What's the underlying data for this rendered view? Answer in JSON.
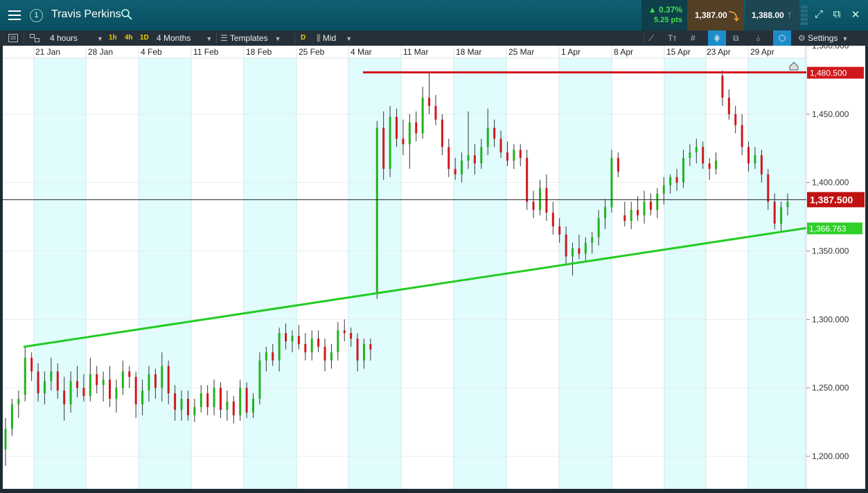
{
  "header": {
    "menu_icon": "hamburger-icon",
    "window_number": "1",
    "title": "Travis Perkins",
    "change_pct": "0.37%",
    "change_pts": "5.25 pts",
    "sell_price": "1,387.00",
    "buy_price": "1,388.00",
    "up_color": "#3fe04a"
  },
  "toolbar": {
    "interval": "4 hours",
    "quick_1h": "1h",
    "quick_4h": "4h",
    "quick_1d": "1D",
    "range": "4 Months",
    "templates": "Templates",
    "d_label": "D",
    "price_type": "Mid",
    "settings": "Settings"
  },
  "chart_data": {
    "type": "candlestick",
    "x_ticks": [
      "21 Jan",
      "28 Jan",
      "4 Feb",
      "11 Feb",
      "18 Feb",
      "25 Feb",
      "4 Mar",
      "11 Mar",
      "18 Mar",
      "25 Mar",
      "1 Apr",
      "8 Apr",
      "15 Apr",
      "23 Apr",
      "29 Apr"
    ],
    "y_ticks": [
      1200,
      1250,
      1300,
      1350,
      1400,
      1450,
      1500
    ],
    "y_tick_labels": [
      "1,200.000",
      "1,250.000",
      "1,300.000",
      "1,350.000",
      "1,400.000",
      "1,450.000",
      "1,500.000"
    ],
    "ylim": [
      1185,
      1506
    ],
    "up_color": "#22b21f",
    "down_color": "#d0171d",
    "current_price": 1387.5,
    "current_price_label": "1,387.500",
    "resistance": {
      "value": 1480.5,
      "label": "1,480.500",
      "color": "#d0171d"
    },
    "support": {
      "value": 1366.763,
      "label": "1,366.763",
      "color": "#22cc22",
      "from": 1280,
      "to": 1366.763
    },
    "series": [
      {
        "o": 1205,
        "h": 1228,
        "l": 1193,
        "c": 1220
      },
      {
        "o": 1220,
        "h": 1242,
        "l": 1215,
        "c": 1238
      },
      {
        "o": 1238,
        "h": 1248,
        "l": 1228,
        "c": 1242
      },
      {
        "o": 1245,
        "h": 1280,
        "l": 1240,
        "c": 1272
      },
      {
        "o": 1272,
        "h": 1276,
        "l": 1255,
        "c": 1262
      },
      {
        "o": 1262,
        "h": 1268,
        "l": 1240,
        "c": 1246
      },
      {
        "o": 1246,
        "h": 1262,
        "l": 1238,
        "c": 1255
      },
      {
        "o": 1255,
        "h": 1272,
        "l": 1248,
        "c": 1262
      },
      {
        "o": 1262,
        "h": 1268,
        "l": 1242,
        "c": 1248
      },
      {
        "o": 1248,
        "h": 1258,
        "l": 1226,
        "c": 1238
      },
      {
        "o": 1238,
        "h": 1262,
        "l": 1232,
        "c": 1255
      },
      {
        "o": 1255,
        "h": 1266,
        "l": 1243,
        "c": 1250
      },
      {
        "o": 1250,
        "h": 1260,
        "l": 1240,
        "c": 1244
      },
      {
        "o": 1244,
        "h": 1272,
        "l": 1240,
        "c": 1260
      },
      {
        "o": 1260,
        "h": 1266,
        "l": 1246,
        "c": 1252
      },
      {
        "o": 1252,
        "h": 1262,
        "l": 1240,
        "c": 1256
      },
      {
        "o": 1256,
        "h": 1266,
        "l": 1236,
        "c": 1242
      },
      {
        "o": 1242,
        "h": 1256,
        "l": 1232,
        "c": 1250
      },
      {
        "o": 1250,
        "h": 1270,
        "l": 1245,
        "c": 1262
      },
      {
        "o": 1262,
        "h": 1266,
        "l": 1250,
        "c": 1258
      },
      {
        "o": 1258,
        "h": 1262,
        "l": 1228,
        "c": 1238
      },
      {
        "o": 1238,
        "h": 1256,
        "l": 1230,
        "c": 1248
      },
      {
        "o": 1248,
        "h": 1266,
        "l": 1240,
        "c": 1260
      },
      {
        "o": 1260,
        "h": 1264,
        "l": 1242,
        "c": 1250
      },
      {
        "o": 1250,
        "h": 1276,
        "l": 1240,
        "c": 1266
      },
      {
        "o": 1266,
        "h": 1270,
        "l": 1238,
        "c": 1246
      },
      {
        "o": 1246,
        "h": 1252,
        "l": 1226,
        "c": 1234
      },
      {
        "o": 1234,
        "h": 1248,
        "l": 1226,
        "c": 1242
      },
      {
        "o": 1242,
        "h": 1248,
        "l": 1226,
        "c": 1230
      },
      {
        "o": 1230,
        "h": 1242,
        "l": 1225,
        "c": 1236
      },
      {
        "o": 1236,
        "h": 1252,
        "l": 1232,
        "c": 1246
      },
      {
        "o": 1246,
        "h": 1252,
        "l": 1230,
        "c": 1236
      },
      {
        "o": 1236,
        "h": 1256,
        "l": 1230,
        "c": 1250
      },
      {
        "o": 1250,
        "h": 1254,
        "l": 1228,
        "c": 1234
      },
      {
        "o": 1234,
        "h": 1248,
        "l": 1226,
        "c": 1240
      },
      {
        "o": 1240,
        "h": 1244,
        "l": 1224,
        "c": 1230
      },
      {
        "o": 1230,
        "h": 1256,
        "l": 1226,
        "c": 1250
      },
      {
        "o": 1250,
        "h": 1254,
        "l": 1228,
        "c": 1232
      },
      {
        "o": 1232,
        "h": 1246,
        "l": 1228,
        "c": 1242
      },
      {
        "o": 1242,
        "h": 1276,
        "l": 1238,
        "c": 1270
      },
      {
        "o": 1270,
        "h": 1280,
        "l": 1262,
        "c": 1276
      },
      {
        "o": 1276,
        "h": 1282,
        "l": 1266,
        "c": 1270
      },
      {
        "o": 1270,
        "h": 1294,
        "l": 1262,
        "c": 1290
      },
      {
        "o": 1290,
        "h": 1297,
        "l": 1278,
        "c": 1284
      },
      {
        "o": 1284,
        "h": 1292,
        "l": 1276,
        "c": 1288
      },
      {
        "o": 1288,
        "h": 1296,
        "l": 1278,
        "c": 1282
      },
      {
        "o": 1282,
        "h": 1290,
        "l": 1270,
        "c": 1276
      },
      {
        "o": 1276,
        "h": 1292,
        "l": 1270,
        "c": 1286
      },
      {
        "o": 1286,
        "h": 1292,
        "l": 1276,
        "c": 1280
      },
      {
        "o": 1280,
        "h": 1286,
        "l": 1262,
        "c": 1270
      },
      {
        "o": 1270,
        "h": 1282,
        "l": 1264,
        "c": 1276
      },
      {
        "o": 1276,
        "h": 1298,
        "l": 1270,
        "c": 1292
      },
      {
        "o": 1292,
        "h": 1300,
        "l": 1284,
        "c": 1290
      },
      {
        "o": 1290,
        "h": 1294,
        "l": 1280,
        "c": 1286
      },
      {
        "o": 1286,
        "h": 1290,
        "l": 1262,
        "c": 1270
      },
      {
        "o": 1270,
        "h": 1286,
        "l": 1264,
        "c": 1282
      },
      {
        "o": 1282,
        "h": 1286,
        "l": 1270,
        "c": 1278
      },
      {
        "o": 1320,
        "h": 1445,
        "l": 1315,
        "c": 1440
      },
      {
        "o": 1440,
        "h": 1452,
        "l": 1402,
        "c": 1410
      },
      {
        "o": 1410,
        "h": 1456,
        "l": 1404,
        "c": 1448
      },
      {
        "o": 1448,
        "h": 1454,
        "l": 1426,
        "c": 1432
      },
      {
        "o": 1432,
        "h": 1446,
        "l": 1420,
        "c": 1428
      },
      {
        "o": 1428,
        "h": 1450,
        "l": 1410,
        "c": 1444
      },
      {
        "o": 1444,
        "h": 1452,
        "l": 1430,
        "c": 1436
      },
      {
        "o": 1436,
        "h": 1470,
        "l": 1432,
        "c": 1462
      },
      {
        "o": 1462,
        "h": 1481,
        "l": 1450,
        "c": 1456
      },
      {
        "o": 1456,
        "h": 1464,
        "l": 1442,
        "c": 1446
      },
      {
        "o": 1446,
        "h": 1450,
        "l": 1420,
        "c": 1426
      },
      {
        "o": 1426,
        "h": 1432,
        "l": 1404,
        "c": 1410
      },
      {
        "o": 1410,
        "h": 1418,
        "l": 1402,
        "c": 1406
      },
      {
        "o": 1406,
        "h": 1422,
        "l": 1400,
        "c": 1416
      },
      {
        "o": 1416,
        "h": 1452,
        "l": 1410,
        "c": 1420
      },
      {
        "o": 1420,
        "h": 1428,
        "l": 1406,
        "c": 1414
      },
      {
        "o": 1414,
        "h": 1432,
        "l": 1410,
        "c": 1426
      },
      {
        "o": 1426,
        "h": 1454,
        "l": 1420,
        "c": 1440
      },
      {
        "o": 1440,
        "h": 1446,
        "l": 1426,
        "c": 1432
      },
      {
        "o": 1432,
        "h": 1438,
        "l": 1418,
        "c": 1422
      },
      {
        "o": 1422,
        "h": 1430,
        "l": 1412,
        "c": 1416
      },
      {
        "o": 1416,
        "h": 1428,
        "l": 1410,
        "c": 1424
      },
      {
        "o": 1424,
        "h": 1428,
        "l": 1412,
        "c": 1418
      },
      {
        "o": 1418,
        "h": 1424,
        "l": 1380,
        "c": 1386
      },
      {
        "o": 1386,
        "h": 1394,
        "l": 1374,
        "c": 1380
      },
      {
        "o": 1380,
        "h": 1402,
        "l": 1376,
        "c": 1396
      },
      {
        "o": 1396,
        "h": 1406,
        "l": 1372,
        "c": 1378
      },
      {
        "o": 1378,
        "h": 1386,
        "l": 1362,
        "c": 1368
      },
      {
        "o": 1368,
        "h": 1374,
        "l": 1356,
        "c": 1362
      },
      {
        "o": 1362,
        "h": 1368,
        "l": 1340,
        "c": 1346
      },
      {
        "o": 1346,
        "h": 1356,
        "l": 1332,
        "c": 1352
      },
      {
        "o": 1352,
        "h": 1362,
        "l": 1344,
        "c": 1348
      },
      {
        "o": 1348,
        "h": 1360,
        "l": 1342,
        "c": 1356
      },
      {
        "o": 1356,
        "h": 1364,
        "l": 1348,
        "c": 1360
      },
      {
        "o": 1360,
        "h": 1380,
        "l": 1354,
        "c": 1374
      },
      {
        "o": 1374,
        "h": 1388,
        "l": 1366,
        "c": 1382
      },
      {
        "o": 1382,
        "h": 1424,
        "l": 1378,
        "c": 1418
      },
      {
        "o": 1418,
        "h": 1422,
        "l": 1404,
        "c": 1408
      },
      {
        "o": 1376,
        "h": 1386,
        "l": 1368,
        "c": 1372
      },
      {
        "o": 1372,
        "h": 1386,
        "l": 1366,
        "c": 1380
      },
      {
        "o": 1380,
        "h": 1390,
        "l": 1372,
        "c": 1376
      },
      {
        "o": 1376,
        "h": 1394,
        "l": 1370,
        "c": 1386
      },
      {
        "o": 1386,
        "h": 1392,
        "l": 1376,
        "c": 1380
      },
      {
        "o": 1380,
        "h": 1396,
        "l": 1374,
        "c": 1392
      },
      {
        "o": 1392,
        "h": 1404,
        "l": 1384,
        "c": 1398
      },
      {
        "o": 1398,
        "h": 1406,
        "l": 1392,
        "c": 1404
      },
      {
        "o": 1404,
        "h": 1410,
        "l": 1394,
        "c": 1400
      },
      {
        "o": 1400,
        "h": 1424,
        "l": 1396,
        "c": 1418
      },
      {
        "o": 1418,
        "h": 1428,
        "l": 1412,
        "c": 1422
      },
      {
        "o": 1422,
        "h": 1432,
        "l": 1414,
        "c": 1426
      },
      {
        "o": 1426,
        "h": 1430,
        "l": 1410,
        "c": 1414
      },
      {
        "o": 1414,
        "h": 1418,
        "l": 1402,
        "c": 1410
      },
      {
        "o": 1410,
        "h": 1422,
        "l": 1406,
        "c": 1416
      },
      {
        "o": 1478,
        "h": 1482,
        "l": 1456,
        "c": 1462
      },
      {
        "o": 1462,
        "h": 1468,
        "l": 1446,
        "c": 1450
      },
      {
        "o": 1450,
        "h": 1456,
        "l": 1436,
        "c": 1442
      },
      {
        "o": 1442,
        "h": 1450,
        "l": 1420,
        "c": 1426
      },
      {
        "o": 1426,
        "h": 1430,
        "l": 1408,
        "c": 1414
      },
      {
        "o": 1414,
        "h": 1426,
        "l": 1410,
        "c": 1420
      },
      {
        "o": 1420,
        "h": 1424,
        "l": 1400,
        "c": 1406
      },
      {
        "o": 1406,
        "h": 1410,
        "l": 1380,
        "c": 1386
      },
      {
        "o": 1386,
        "h": 1392,
        "l": 1366,
        "c": 1370
      },
      {
        "o": 1370,
        "h": 1386,
        "l": 1364,
        "c": 1382
      },
      {
        "o": 1382,
        "h": 1392,
        "l": 1376,
        "c": 1386
      }
    ]
  }
}
